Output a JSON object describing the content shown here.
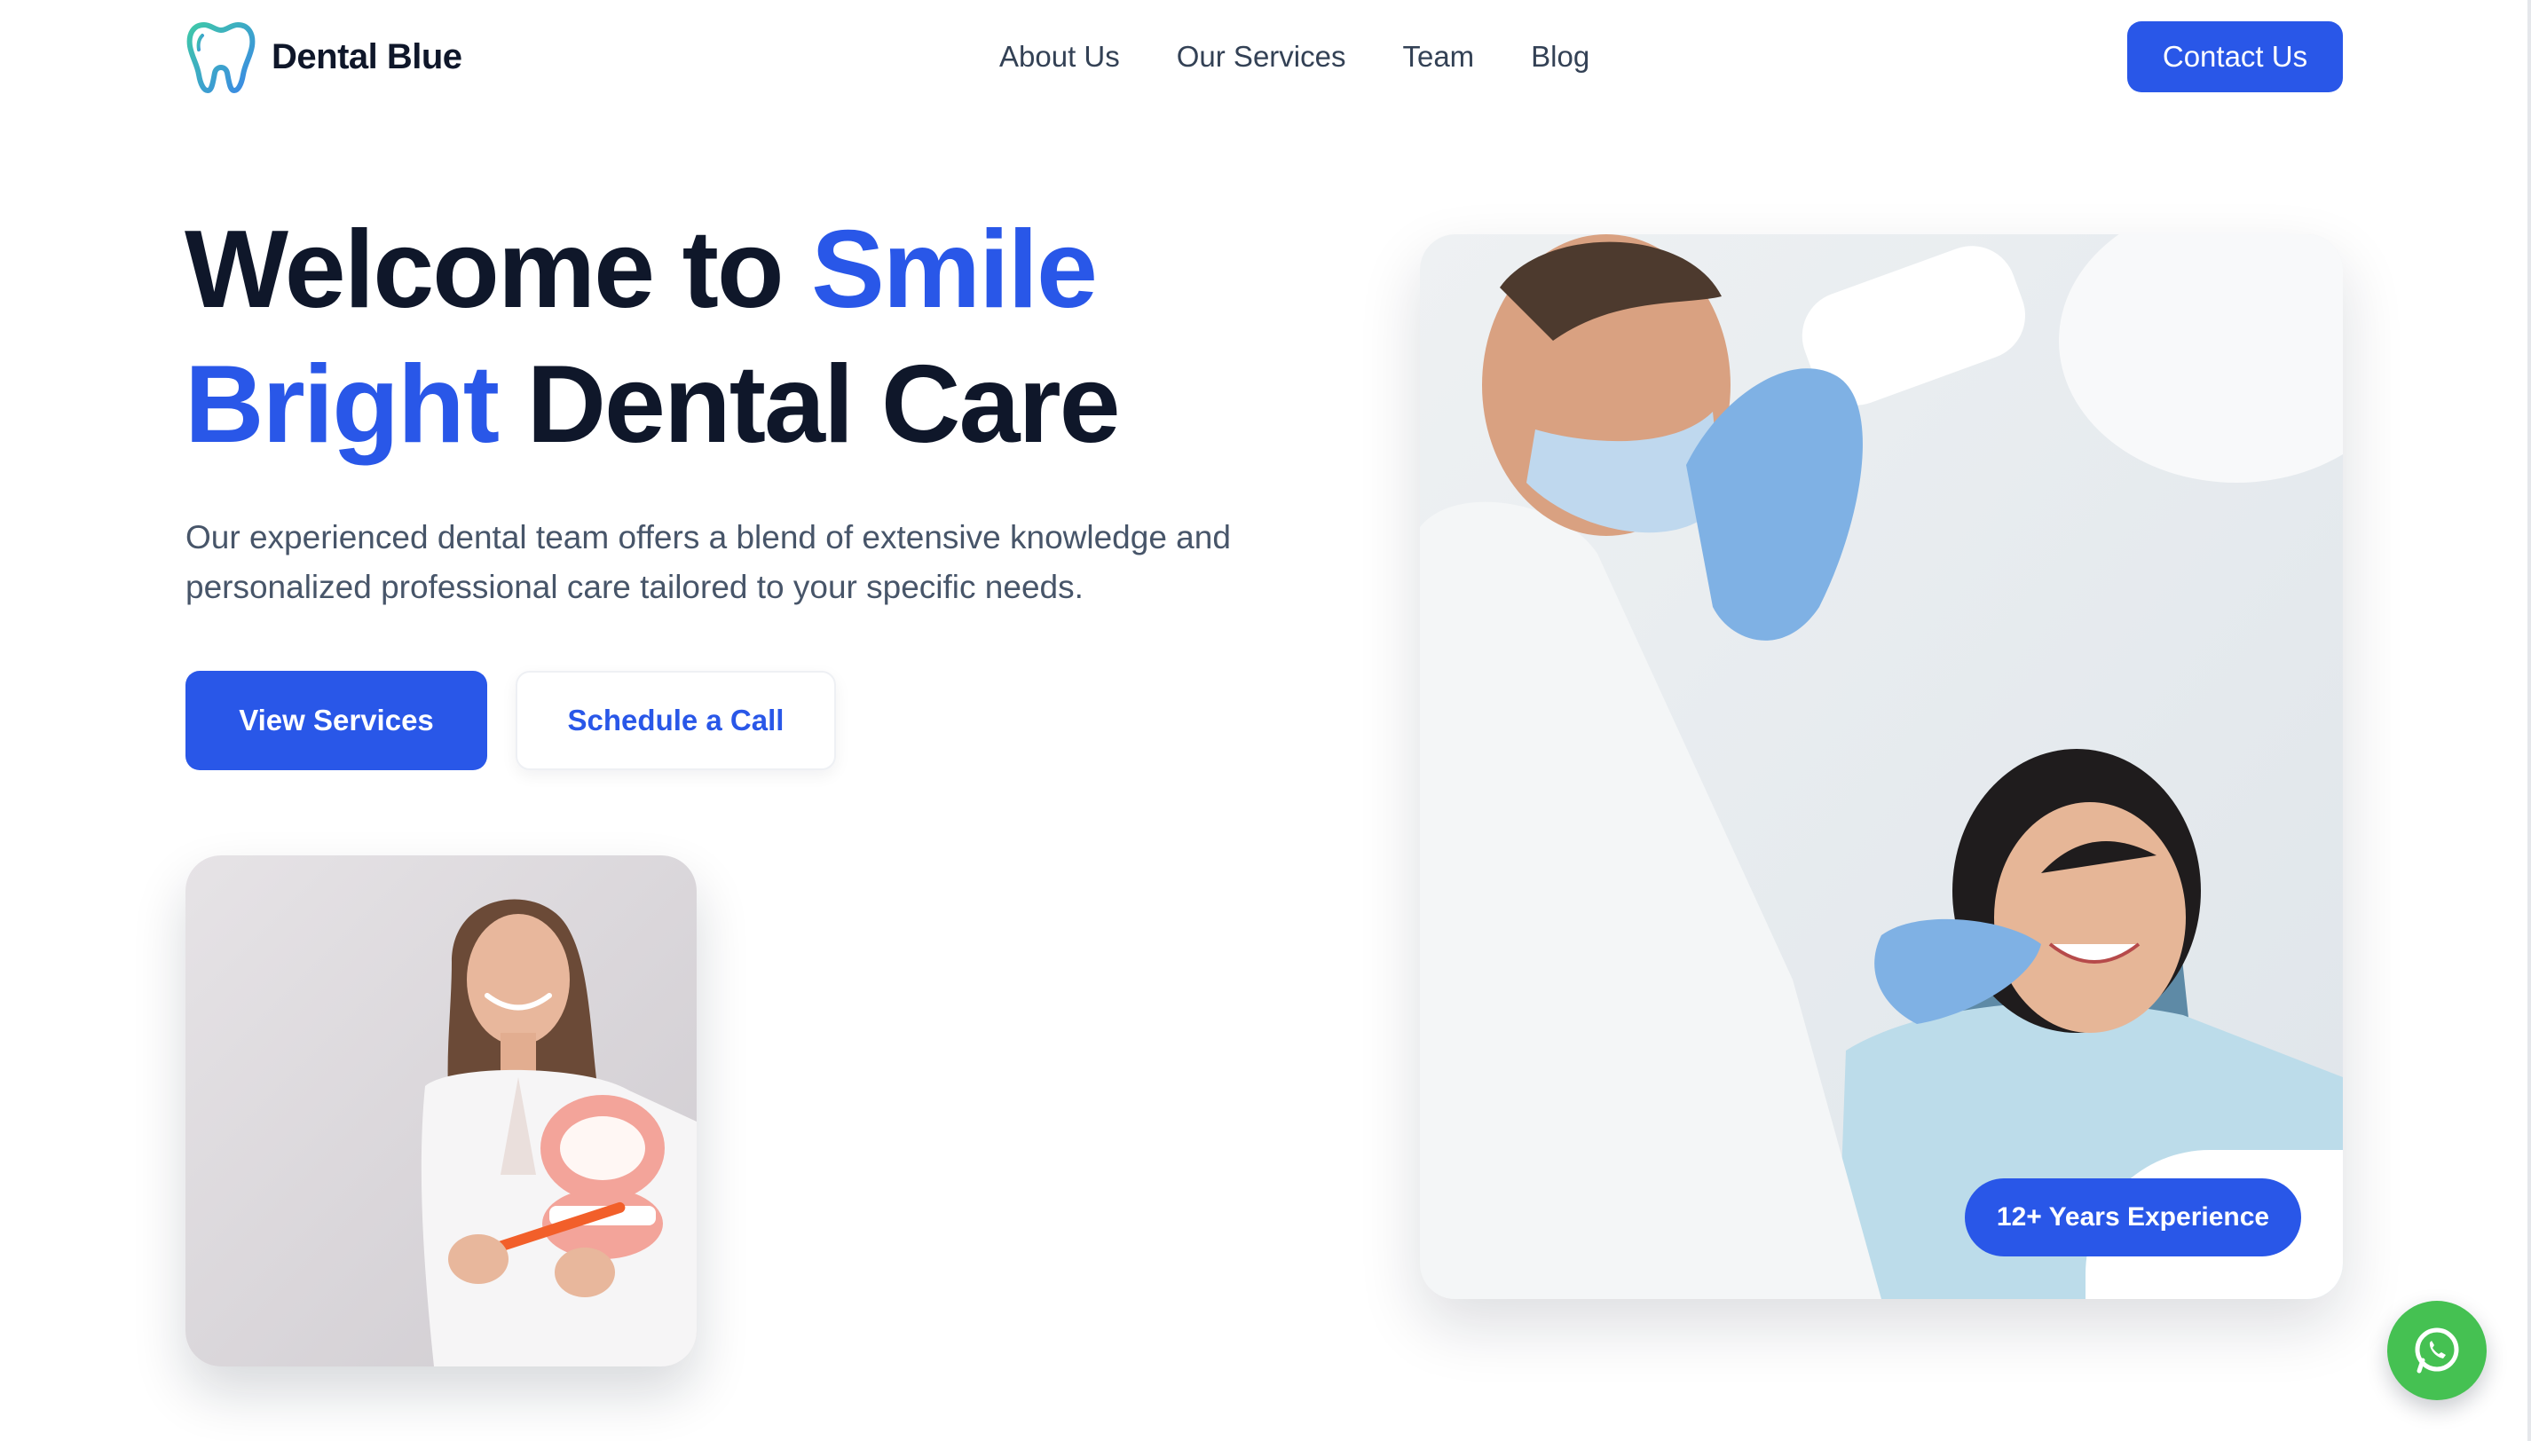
{
  "brand": {
    "name": "Dental Blue",
    "logo_icon": "tooth-icon",
    "accent_color": "#2957e8",
    "logo_gradient": [
      "#3fc8a8",
      "#3a86e8"
    ]
  },
  "nav": {
    "items": [
      {
        "label": "About Us"
      },
      {
        "label": "Our Services"
      },
      {
        "label": "Team"
      },
      {
        "label": "Blog"
      }
    ],
    "cta_label": "Contact Us"
  },
  "hero": {
    "title_part1": "Welcome to ",
    "title_accent": "Smile Bright",
    "title_part2": " Dental Care",
    "description": "Our experienced dental team offers a blend of extensive knowledge and personalized professional care tailored to your specific needs.",
    "primary_button": "View Services",
    "secondary_button": "Schedule a Call"
  },
  "images": {
    "small": "woman-with-tooth-model-photo",
    "large": "dentist-examining-patient-photo"
  },
  "badge": {
    "label": "12+ Years Experience"
  },
  "floating": {
    "icon": "whatsapp-icon",
    "color": "#45c152"
  }
}
